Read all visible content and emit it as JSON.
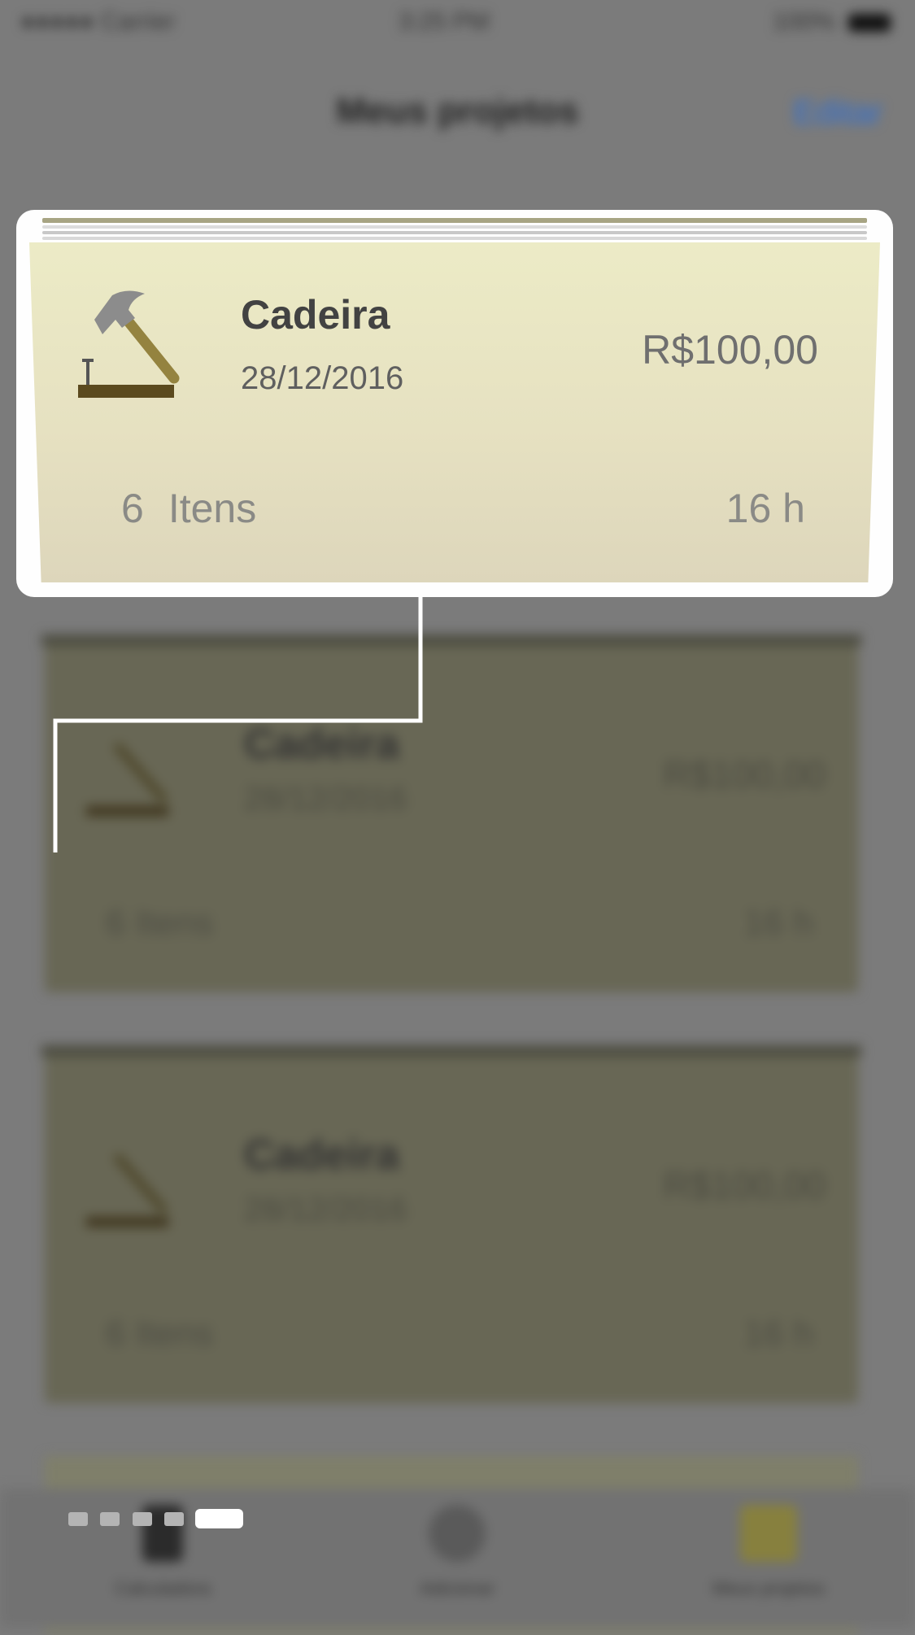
{
  "status_bar": {
    "carrier": "●●●●● Carrier",
    "time": "3:25 PM",
    "battery": "100%"
  },
  "nav": {
    "title": "Meus projetos",
    "edit_label": "Editar"
  },
  "highlighted_project": {
    "name": "Cadeira",
    "date": "28/12/2016",
    "price": "R$100,00",
    "item_count": "6",
    "item_label": "Itens",
    "hours": "16 h",
    "icon": "hammer-nail-icon"
  },
  "background_projects": [
    {
      "name": "Cadeira",
      "date": "28/12/2016",
      "price": "R$100,00",
      "count": "6 Itens",
      "hours": "16 h"
    },
    {
      "name": "Cadeira",
      "date": "28/12/2016",
      "price": "R$100,00",
      "count": "6 Itens",
      "hours": "16 h"
    }
  ],
  "tab_bar": {
    "tabs": [
      {
        "label": "Calculadora",
        "icon": "calculator-icon"
      },
      {
        "label": "Adicionar",
        "icon": "share-icon"
      },
      {
        "label": "Meus projetos",
        "icon": "folder-icon"
      }
    ]
  },
  "tutorial": {
    "total_steps": 5,
    "current_step": 5
  },
  "colors": {
    "card_bg": "#ecebc6",
    "highlight_frame": "#ffffff",
    "accent_blue": "#2d6fd6",
    "hammer_head": "#8c8c8c",
    "hammer_handle": "#94833f",
    "board": "#5b4a1e"
  }
}
